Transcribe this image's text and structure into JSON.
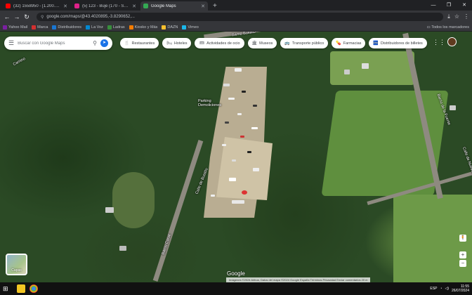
{
  "browser": {
    "tabs": [
      {
        "title": "(32) 1558950 - [1.200.145, ...]",
        "color": "#ff0000",
        "active": false
      },
      {
        "title": "(5) 123 - Buje (170 - Santander)",
        "color": "#e0218a",
        "active": false
      },
      {
        "title": "Google Maps",
        "color": "#34a853",
        "active": true
      }
    ],
    "new_tab": "+",
    "window_controls": {
      "minimize": "—",
      "restore": "❐",
      "close": "✕"
    },
    "url": "google.com/maps/@43.4020895,-3.8290652,...",
    "toolbar_icons": [
      "⤓",
      "☆",
      "⋮"
    ],
    "bookmarks": [
      "Yahoo Mail",
      "Marca",
      "Distribuidores",
      "La Voz",
      "Ladras",
      "Kiosko y Más",
      "DAZN",
      "Vimeo"
    ],
    "all_bookmarks": "Todos los marcadores"
  },
  "map": {
    "search": {
      "placeholder": "Buscar con Google Maps"
    },
    "chips": [
      {
        "icon": "🍴",
        "label": "Restaurantes"
      },
      {
        "icon": "🛏",
        "label": "Hoteles"
      },
      {
        "icon": "🎟",
        "label": "Actividades de ocio"
      },
      {
        "icon": "🏛",
        "label": "Museos"
      },
      {
        "icon": "🚌",
        "label": "Transporte público"
      },
      {
        "icon": "💊",
        "label": "Farmacias"
      },
      {
        "icon": "🏧",
        "label": "Distribuidores de billetes"
      }
    ],
    "place_label": "Parking\nDemoliciones",
    "road_labels": [
      "Camino",
      "Barrio Bustillo",
      "Calle de Bustillo",
      "Barrio Canal",
      "Barrio de la Fuente",
      "Calle de Nuestra Señora"
    ],
    "layers_label": "Capas",
    "google": "Google",
    "attribution": "Imágenes ©2024 Airbus, Datos del mapa ©2024 Google  España  Términos  Privacidad  Enviar comentarios  20 m",
    "zoom_in": "+",
    "zoom_out": "−",
    "pegman": "🧍"
  },
  "taskbar": {
    "start": "⊞",
    "time": "11:55",
    "date": "26/07/2024",
    "lang": "ESP"
  }
}
